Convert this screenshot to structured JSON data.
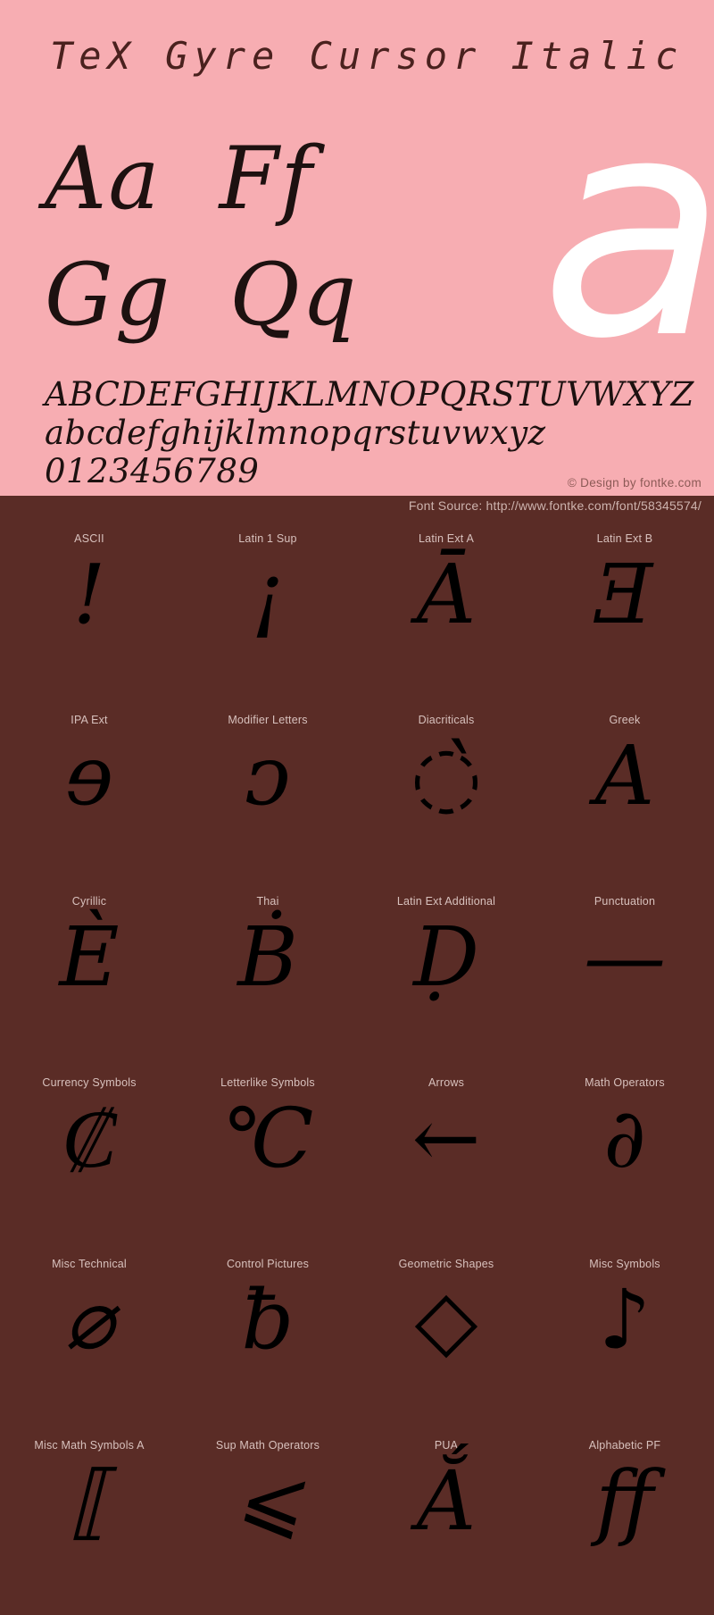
{
  "specimen": {
    "title": "TeX Gyre Cursor Italic",
    "watermark_glyph": "a",
    "big_rows": [
      "Aa  Ff",
      "Gg  Qq"
    ],
    "alphabet_rows": [
      "ABCDEFGHIJKLMNOPQRSTUVWXYZ",
      "abcdefghijklmnopqrstuvwxyz",
      "0123456789"
    ],
    "credit": "© Design by fontke.com",
    "colors": {
      "background": "#f7adb2",
      "text": "#1d1110",
      "title": "#4a211e",
      "watermark": "#ffffff",
      "credit": "#8c5a56"
    }
  },
  "glyph_panel": {
    "source": "Font Source: http://www.fontke.com/font/58345574/",
    "colors": {
      "background": "#5a2c26",
      "label": "#d8c1bd",
      "glyph": "#000000",
      "source": "#cdb3ae"
    },
    "rows": [
      [
        {
          "label": "ASCII",
          "glyph": "!"
        },
        {
          "label": "Latin 1 Sup",
          "glyph": "¡"
        },
        {
          "label": "Latin Ext A",
          "glyph": "Ā"
        },
        {
          "label": "Latin Ext B",
          "glyph": "Ǝ"
        }
      ],
      [
        {
          "label": "IPA Ext",
          "glyph": "ɘ"
        },
        {
          "label": "Modifier Letters",
          "glyph": "ᴐ"
        },
        {
          "label": "Diacriticals",
          "glyph": "◌̀"
        },
        {
          "label": "Greek",
          "glyph": "Α"
        }
      ],
      [
        {
          "label": "Cyrillic",
          "glyph": "Ѐ"
        },
        {
          "label": "Thai",
          "glyph": "Ḃ"
        },
        {
          "label": "Latin Ext Additional",
          "glyph": "Ḍ"
        },
        {
          "label": "Punctuation",
          "glyph": "—"
        }
      ],
      [
        {
          "label": "Currency Symbols",
          "glyph": "₡"
        },
        {
          "label": "Letterlike Symbols",
          "glyph": "℃"
        },
        {
          "label": "Arrows",
          "glyph": "←"
        },
        {
          "label": "Math Operators",
          "glyph": "∂"
        }
      ],
      [
        {
          "label": "Misc Technical",
          "glyph": "⌀"
        },
        {
          "label": "Control Pictures",
          "glyph": "ƀ"
        },
        {
          "label": "Geometric Shapes",
          "glyph": "◇"
        },
        {
          "label": "Misc Symbols",
          "glyph": "♪"
        }
      ],
      [
        {
          "label": "Misc Math Symbols A",
          "glyph": "⟦"
        },
        {
          "label": "Sup Math Operators",
          "glyph": "⩽"
        },
        {
          "label": "PUA",
          "glyph": "Ắ"
        },
        {
          "label": "Alphabetic PF",
          "glyph": "ff"
        }
      ]
    ]
  }
}
